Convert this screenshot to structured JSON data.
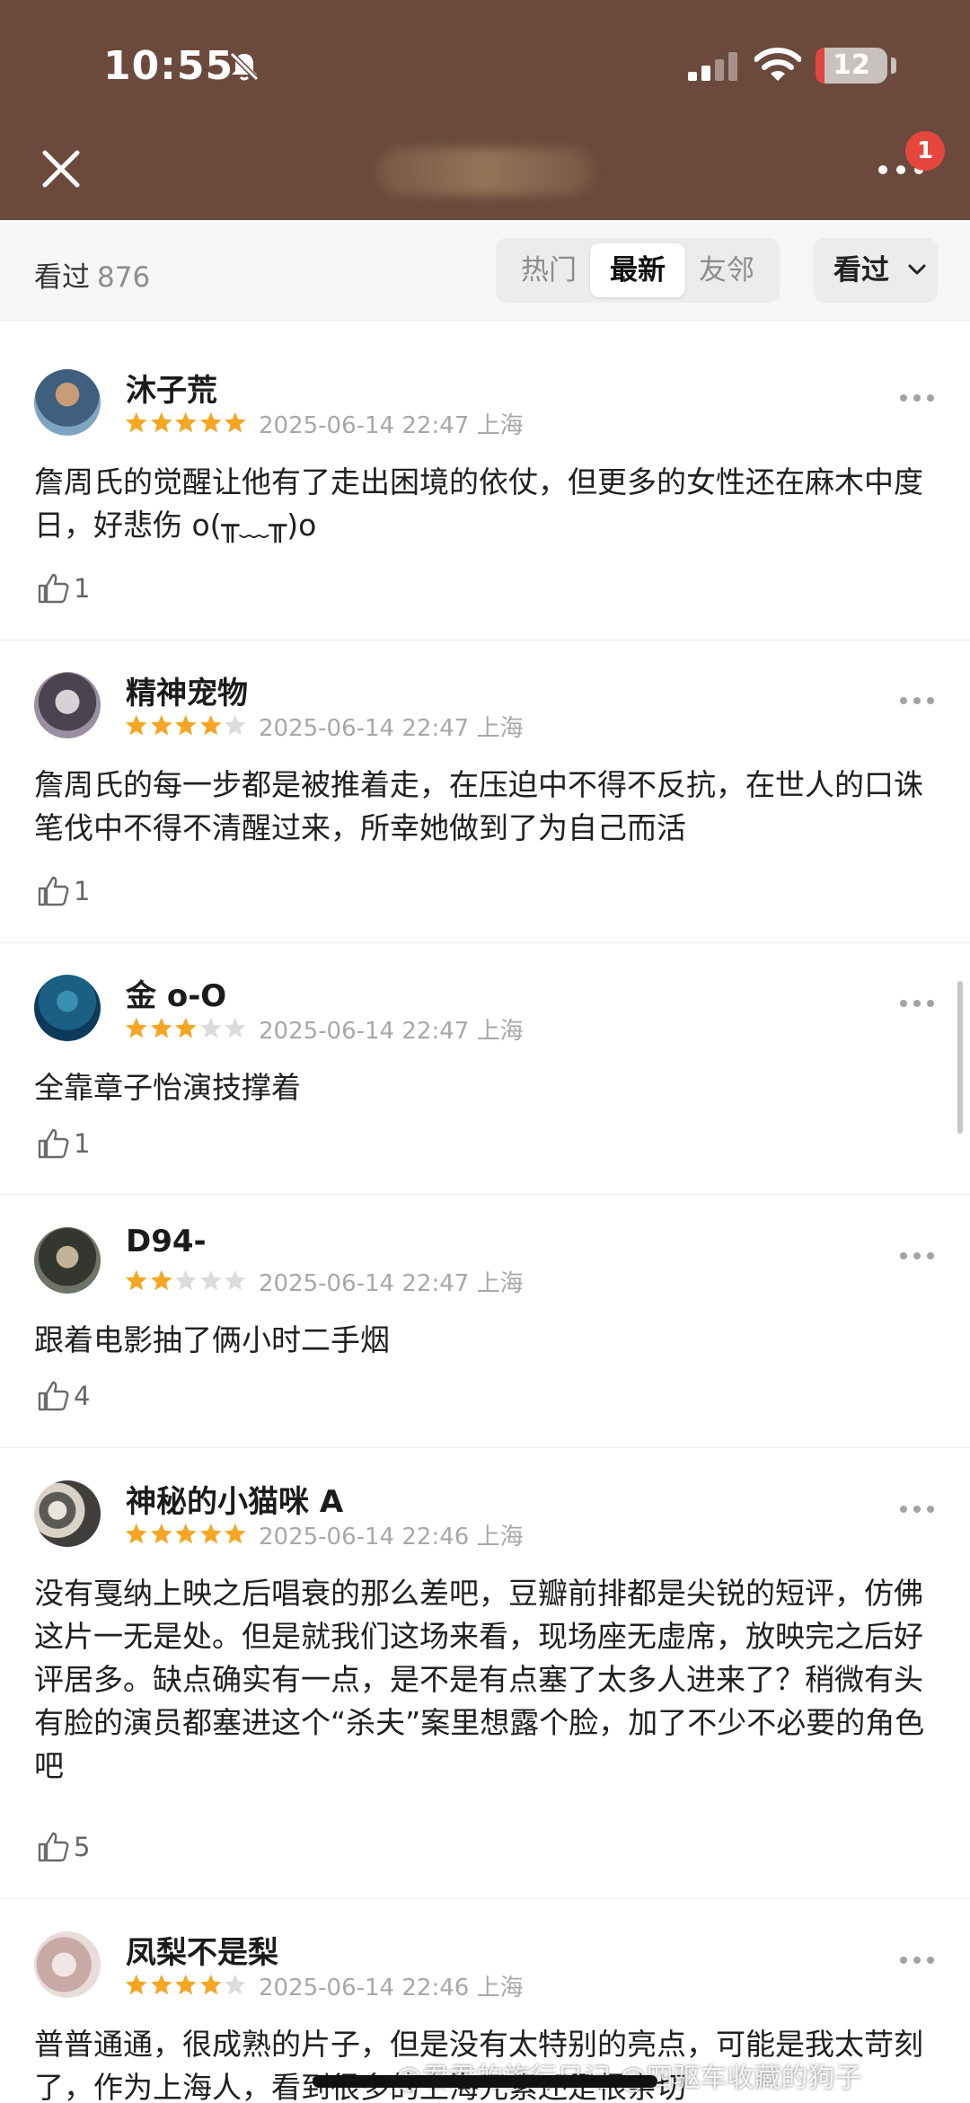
{
  "status_bar": {
    "time": "10:55",
    "battery": "12",
    "battery_level": 0.12,
    "battery_color": "#e0463f"
  },
  "header": {
    "background": "#6b4a3d",
    "notification_count": "1"
  },
  "filter": {
    "label": "看过",
    "count": "876",
    "tabs": [
      "热门",
      "最新",
      "友邻"
    ],
    "active_tab": "最新",
    "dropdown": "看过"
  },
  "reviews": [
    {
      "user": "沐子荒",
      "rating": 5,
      "date": "2025-06-14 22:47",
      "location": "上海",
      "text": "詹周氏的觉醒让他有了走出困境的依仗，但更多的女性还在麻木中度日，好悲伤 o(╥﹏╥)o",
      "likes": "1"
    },
    {
      "user": "精神宠物",
      "rating": 4,
      "date": "2025-06-14 22:47",
      "location": "上海",
      "text": "詹周氏的每一步都是被推着走，在压迫中不得不反抗，在世人的口诛笔伐中不得不清醒过来，所幸她做到了为自己而活",
      "likes": "1"
    },
    {
      "user": "金 o-O",
      "rating": 3,
      "date": "2025-06-14 22:47",
      "location": "上海",
      "text": "全靠章子怡演技撑着",
      "likes": "1"
    },
    {
      "user": "D94-",
      "rating": 2,
      "date": "2025-06-14 22:47",
      "location": "上海",
      "text": "跟着电影抽了俩小时二手烟",
      "likes": "4"
    },
    {
      "user": "神秘的小猫咪 A",
      "rating": 5,
      "date": "2025-06-14 22:46",
      "location": "上海",
      "text": "没有戛纳上映之后唱衰的那么差吧，豆瓣前排都是尖锐的短评，仿佛这片一无是处。但是就我们这场来看，现场座无虚席，放映完之后好评居多。缺点确实有一点，是不是有点塞了太多人进来了？稍微有头有脸的演员都塞进这个“杀夫”案里想露个脸，加了不少不必要的角色吧",
      "likes": "5"
    },
    {
      "user": "凤梨不是梨",
      "rating": 4,
      "date": "2025-06-14 22:46",
      "location": "上海",
      "text": "普普通通，很成熟的片子，但是没有太特别的亮点，可能是我太苛刻了，作为上海人，看到很多的上海元素还是很亲切",
      "likes": ""
    }
  ],
  "watermark": "@君君的旅行日记  @四驱车收藏的狗子",
  "colors": {
    "star": "#f5a623",
    "star_empty": "#dcdcdc",
    "accent_badge": "#e5473f"
  }
}
